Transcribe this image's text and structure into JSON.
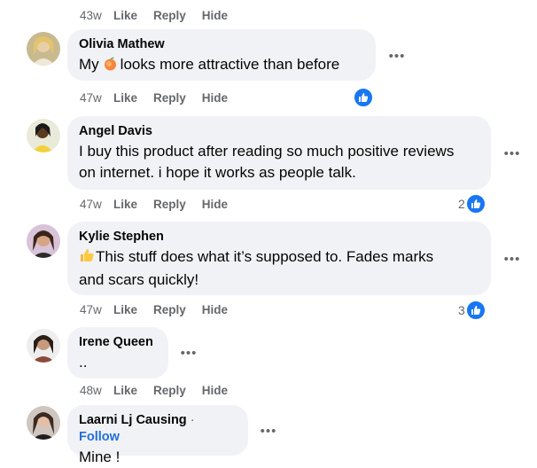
{
  "top_meta": {
    "time": "43w",
    "like": "Like",
    "reply": "Reply",
    "hide": "Hide"
  },
  "comments": [
    {
      "author": "Olivia Mathew",
      "text_before": "My",
      "emoji": "peach-emoji",
      "text_after": "looks more attractive than before",
      "time": "47w",
      "like": "Like",
      "reply": "Reply",
      "hide": "Hide",
      "reaction_count": ""
    },
    {
      "author": "Angel Davis",
      "line1": "I buy this product after reading so much positive reviews",
      "line2": "on internet. i hope it works as people talk.",
      "time": "47w",
      "like": "Like",
      "reply": "Reply",
      "hide": "Hide",
      "reaction_count": "2"
    },
    {
      "author": "Kylie Stephen",
      "emoji": "thumbs-up-emoji",
      "line1": "This stuff does what it’s supposed to. Fades marks",
      "line2": "and scars quickly!",
      "time": "47w",
      "like": "Like",
      "reply": "Reply",
      "hide": "Hide",
      "reaction_count": "3"
    },
    {
      "author": "Irene Queen",
      "text": "..",
      "time": "48w",
      "like": "Like",
      "reply": "Reply",
      "hide": "Hide"
    },
    {
      "author": "Laarni Lj Causing",
      "separator": "·",
      "follow": "Follow",
      "text": "Mine !"
    }
  ],
  "more_label": "•••",
  "colors": {
    "bubble": "#f0f2f5",
    "meta": "#65676b",
    "like_blue": "#1877f2",
    "follow": "#216fdb"
  }
}
